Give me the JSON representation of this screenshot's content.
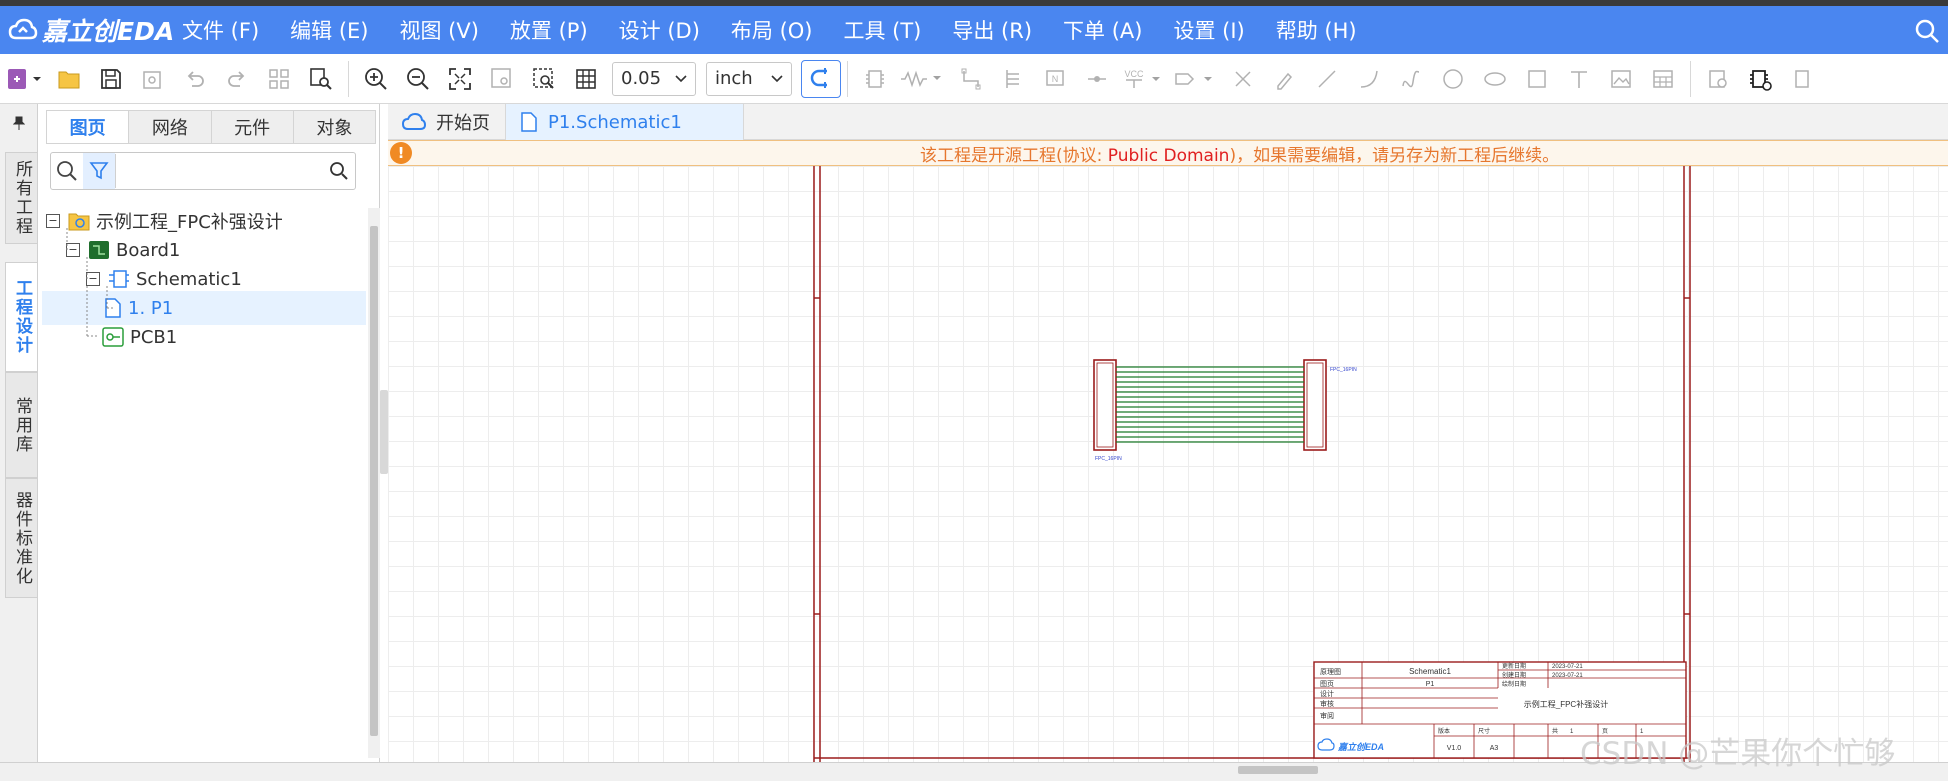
{
  "app": {
    "logo_text": "嘉立创EDA"
  },
  "menu": [
    "文件 (F)",
    "编辑 (E)",
    "视图 (V)",
    "放置 (P)",
    "设计 (D)",
    "布局 (O)",
    "工具 (T)",
    "导出 (R)",
    "下单 (A)",
    "设置 (I)",
    "帮助 (H)"
  ],
  "toolbar": {
    "grid_value": "0.05",
    "unit_value": "inch",
    "vcc_label": "VCC",
    "netflag_label": "N"
  },
  "left_strip": {
    "tabs": [
      "所有工程",
      "工程设计",
      "常用库",
      "器件标准化"
    ]
  },
  "panel": {
    "tabs": [
      "图页",
      "网络",
      "元件",
      "对象"
    ],
    "search_placeholder": "",
    "tree": [
      {
        "label": "示例工程_FPC补强设计"
      },
      {
        "label": "Board1"
      },
      {
        "label": "Schematic1"
      },
      {
        "label": "1. P1"
      },
      {
        "label": "PCB1"
      }
    ]
  },
  "doc_tabs": [
    "开始页",
    "P1.Schematic1"
  ],
  "notice": {
    "pre": "该工程是开源工程(协议: ",
    "license": "Public Domain",
    "post": ")，如果需要编辑，请另存为新工程后继续。"
  },
  "schematic": {
    "conn_left_label": "FPC_16PIN",
    "conn_right_label": "FPC_16PIN",
    "title_block": {
      "sheet_label": "原理图",
      "schematic_name": "Schematic1",
      "page_label": "图页",
      "page_name": "P1",
      "project_name": "示例工程_FPC补强设计",
      "update_label": "更新日期",
      "update_date": "2023-07-21",
      "create_label": "创建日期",
      "create_date": "2023-07-21",
      "draw_label": "绘制日期",
      "design_label": "设计",
      "check_label": "审核",
      "review_label": "审阅",
      "version_label": "版本",
      "version": "V1.0",
      "size_label": "尺寸",
      "size": "A3",
      "page_num_label": "页",
      "page_num": "1",
      "total_label": "共",
      "total": "1",
      "brand": "嘉立创EDA"
    }
  },
  "watermark": "CSDN @芒果你个忙够"
}
